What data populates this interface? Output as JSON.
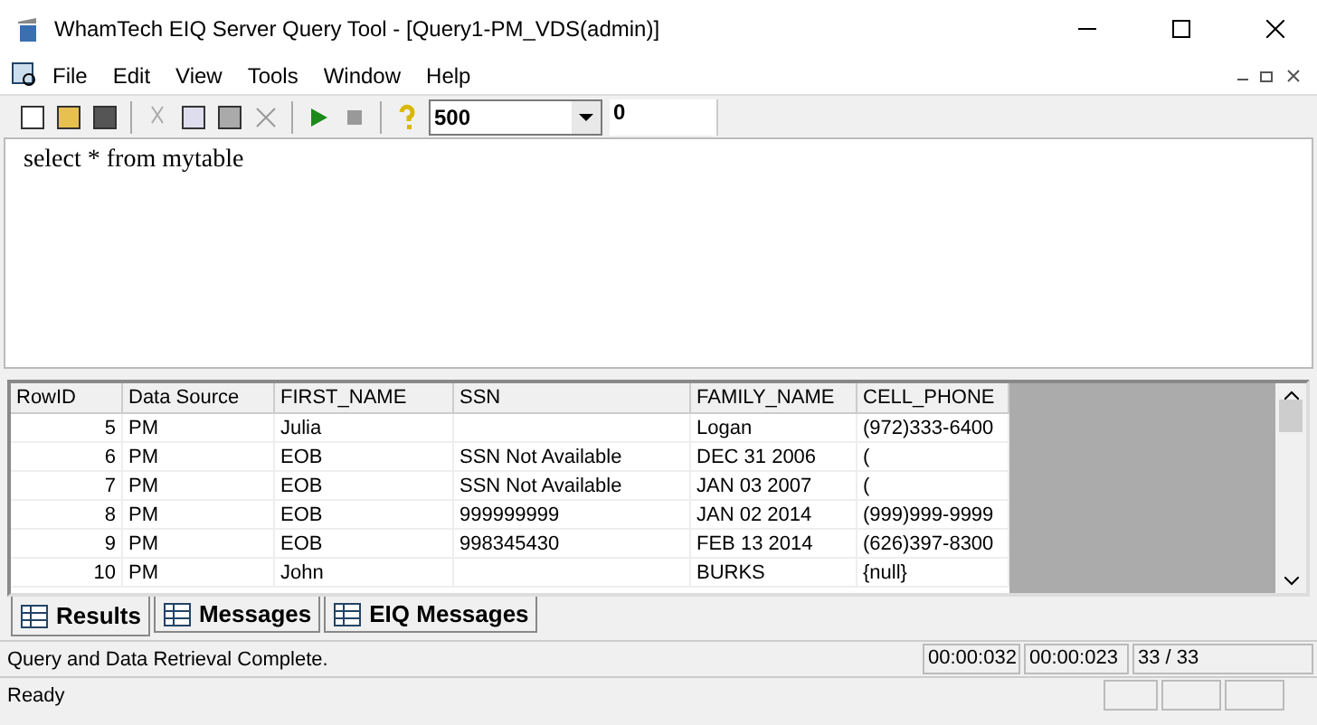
{
  "window": {
    "title": "WhamTech EIQ Server Query Tool - [Query1-PM_VDS(admin)]"
  },
  "menu": [
    "File",
    "Edit",
    "View",
    "Tools",
    "Window",
    "Help"
  ],
  "toolbar": {
    "row_limit": "500",
    "count": "0"
  },
  "editor": {
    "value": "select * from mytable"
  },
  "table": {
    "columns": [
      "RowID",
      "Data Source",
      "FIRST_NAME",
      "SSN",
      "FAMILY_NAME",
      "CELL_PHONE"
    ],
    "rows": [
      [
        "5",
        "PM",
        "Julia",
        "",
        "Logan",
        "(972)333-6400"
      ],
      [
        "6",
        "PM",
        "EOB",
        "SSN Not Available",
        "DEC 31 2006",
        "("
      ],
      [
        "7",
        "PM",
        "EOB",
        "SSN Not Available",
        "JAN 03 2007",
        "("
      ],
      [
        "8",
        "PM",
        "EOB",
        "999999999",
        "JAN 02 2014",
        "(999)999-9999"
      ],
      [
        "9",
        "PM",
        "EOB",
        "998345430",
        "FEB 13 2014",
        "(626)397-8300"
      ],
      [
        "10",
        "PM",
        "John",
        "",
        "BURKS",
        "{null}"
      ]
    ]
  },
  "tabs": [
    {
      "label": "Results",
      "selected": true
    },
    {
      "label": "Messages",
      "selected": false
    },
    {
      "label": "EIQ Messages",
      "selected": false
    }
  ],
  "status": {
    "message": "Query and Data Retrieval Complete.",
    "times": [
      "00:00:032",
      "00:00:023"
    ],
    "rows": "33 / 33"
  },
  "status_bar": {
    "text": "Ready"
  }
}
